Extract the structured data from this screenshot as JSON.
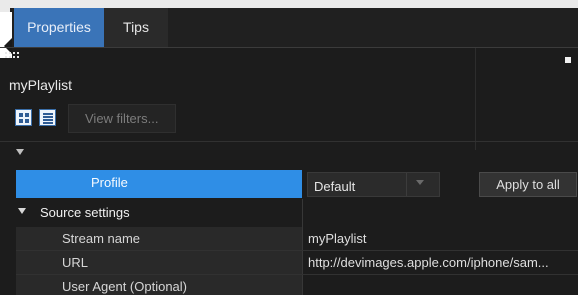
{
  "tabs": [
    {
      "label": "Properties",
      "active": true
    },
    {
      "label": "Tips",
      "active": false
    }
  ],
  "header": {
    "title": "myPlaylist",
    "view_filters_label": "View filters..."
  },
  "profile": {
    "label": "Profile",
    "select_value": "Default",
    "apply_label": "Apply to all"
  },
  "section": {
    "label": "Source settings"
  },
  "properties": [
    {
      "label": "Stream name",
      "value": "myPlaylist"
    },
    {
      "label": "URL",
      "value": "http://devimages.apple.com/iphone/sam..."
    },
    {
      "label": "User Agent (Optional)",
      "value": ""
    }
  ],
  "colors": {
    "active_tab": "#3a74b8",
    "selection": "#2f8ee6",
    "panel_bg": "#1c1c1c"
  },
  "icons": [
    "grip-icon",
    "panel-menu-icon",
    "collapse-arrow-icon",
    "grid-view-icon",
    "list-view-icon",
    "dropdown-chevron-icon"
  ]
}
